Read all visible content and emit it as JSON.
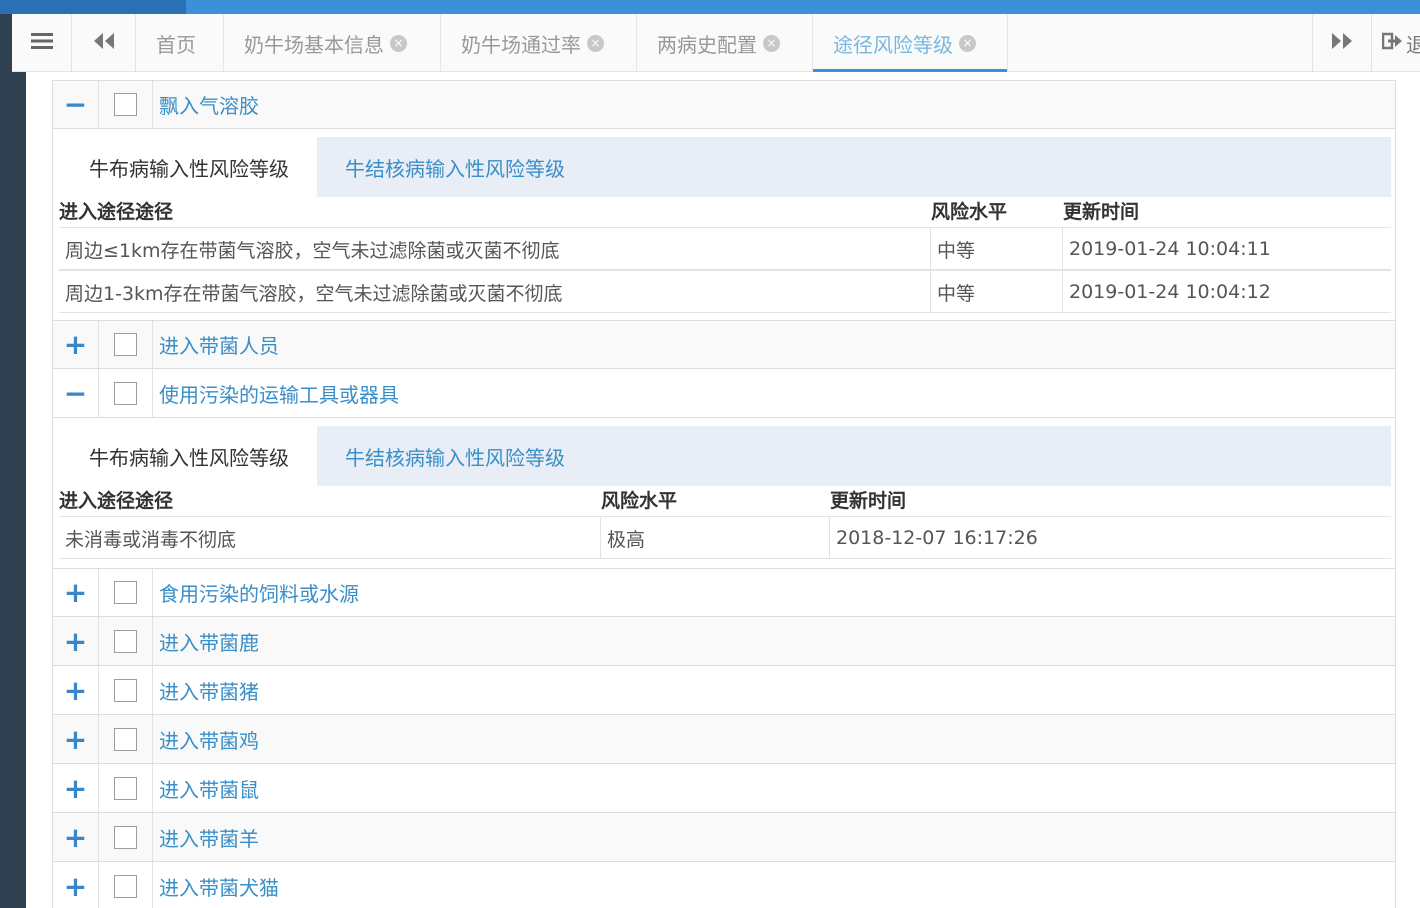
{
  "tabbar": {
    "tabs": [
      {
        "label": "首页",
        "closable": false,
        "active": false
      },
      {
        "label": "奶牛场基本信息",
        "closable": true,
        "active": false
      },
      {
        "label": "奶牛场通过率",
        "closable": true,
        "active": false
      },
      {
        "label": "两病史配置",
        "closable": true,
        "active": false
      },
      {
        "label": "途径风险等级",
        "closable": true,
        "active": true
      }
    ],
    "close_glyph": "×",
    "logout_label": "退",
    "icons": {
      "menu": "hamburger-icon",
      "prev": "double-chevron-left-icon",
      "next": "double-chevron-right-icon",
      "logout": "sign-out-icon"
    }
  },
  "glyphs": {
    "expanded": "−",
    "collapsed": "+"
  },
  "rows": [
    {
      "label": "飘入气溶胶",
      "expanded": true
    },
    {
      "label": "进入带菌人员",
      "expanded": false
    },
    {
      "label": "使用污染的运输工具或器具",
      "expanded": true
    },
    {
      "label": "食用污染的饲料或水源",
      "expanded": false
    },
    {
      "label": "进入带菌鹿",
      "expanded": false
    },
    {
      "label": "进入带菌猪",
      "expanded": false
    },
    {
      "label": "进入带菌鸡",
      "expanded": false
    },
    {
      "label": "进入带菌鼠",
      "expanded": false
    },
    {
      "label": "进入带菌羊",
      "expanded": false
    },
    {
      "label": "进入带菌犬猫",
      "expanded": false
    }
  ],
  "details": [
    {
      "subtabs": [
        "牛布病输入性风险等级",
        "牛结核病输入性风险等级"
      ],
      "columns": [
        "进入途径途径",
        "风险水平",
        "更新时间"
      ],
      "rows": [
        [
          "周边≤1km存在带菌气溶胶，空气未过滤除菌或灭菌不彻底",
          "中等",
          "2019-01-24 10:04:11"
        ],
        [
          "周边1-3km存在带菌气溶胶，空气未过滤除菌或灭菌不彻底",
          "中等",
          "2019-01-24 10:04:12"
        ]
      ]
    },
    {
      "subtabs": [
        "牛布病输入性风险等级",
        "牛结核病输入性风险等级"
      ],
      "columns": [
        "进入途径途径",
        "风险水平",
        "更新时间"
      ],
      "rows": [
        [
          "未消毒或消毒不彻底",
          "极高",
          "2018-12-07 16:17:26"
        ]
      ]
    }
  ]
}
